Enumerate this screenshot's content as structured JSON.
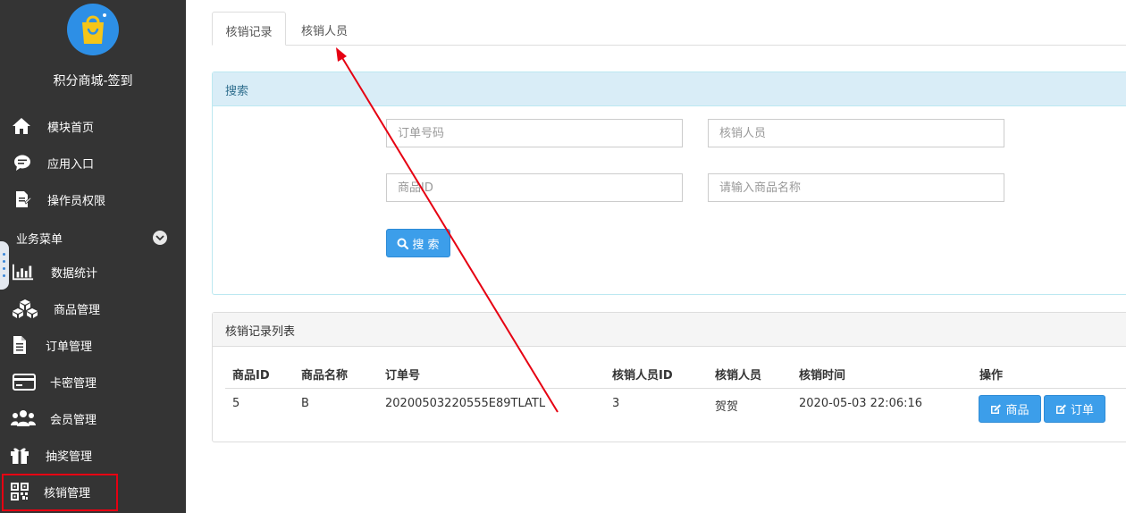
{
  "app": {
    "title": "积分商城-签到"
  },
  "sidebar": {
    "items": [
      {
        "label": "模块首页",
        "icon": "home-icon"
      },
      {
        "label": "应用入口",
        "icon": "chat-bubble-icon"
      },
      {
        "label": "操作员权限",
        "icon": "document-edit-icon"
      }
    ],
    "section_label": "业务菜单",
    "business_items": [
      {
        "label": "数据统计",
        "icon": "bar-chart-icon"
      },
      {
        "label": "商品管理",
        "icon": "cubes-icon"
      },
      {
        "label": "订单管理",
        "icon": "file-text-icon"
      },
      {
        "label": "卡密管理",
        "icon": "credit-card-icon"
      },
      {
        "label": "会员管理",
        "icon": "users-icon"
      },
      {
        "label": "抽奖管理",
        "icon": "gift-icon"
      },
      {
        "label": "核销管理",
        "icon": "qrcode-icon",
        "active": true
      }
    ]
  },
  "tabs": [
    {
      "label": "核销记录",
      "active": true
    },
    {
      "label": "核销人员",
      "active": false
    }
  ],
  "search": {
    "title": "搜索",
    "order_no_placeholder": "订单号码",
    "staff_placeholder": "核销人员",
    "goods_id_placeholder": "商品ID",
    "goods_name_placeholder": "请输入商品名称",
    "button_label": "搜 索"
  },
  "list": {
    "title": "核销记录列表",
    "columns": [
      "商品ID",
      "商品名称",
      "订单号",
      "核销人员ID",
      "核销人员",
      "核销时间",
      "操作"
    ],
    "rows": [
      {
        "goods_id": "5",
        "goods_name": "B",
        "order_no": "20200503220555E89TLATL",
        "staff_id": "3",
        "staff_name": "贺贺",
        "time": "2020-05-03 22:06:16",
        "actions": [
          "商品",
          "订单"
        ]
      }
    ]
  },
  "colors": {
    "sidebar_bg": "#343434",
    "primary": "#3c9eea",
    "annotation": "#e60012",
    "search_header": "#d9edf7"
  }
}
